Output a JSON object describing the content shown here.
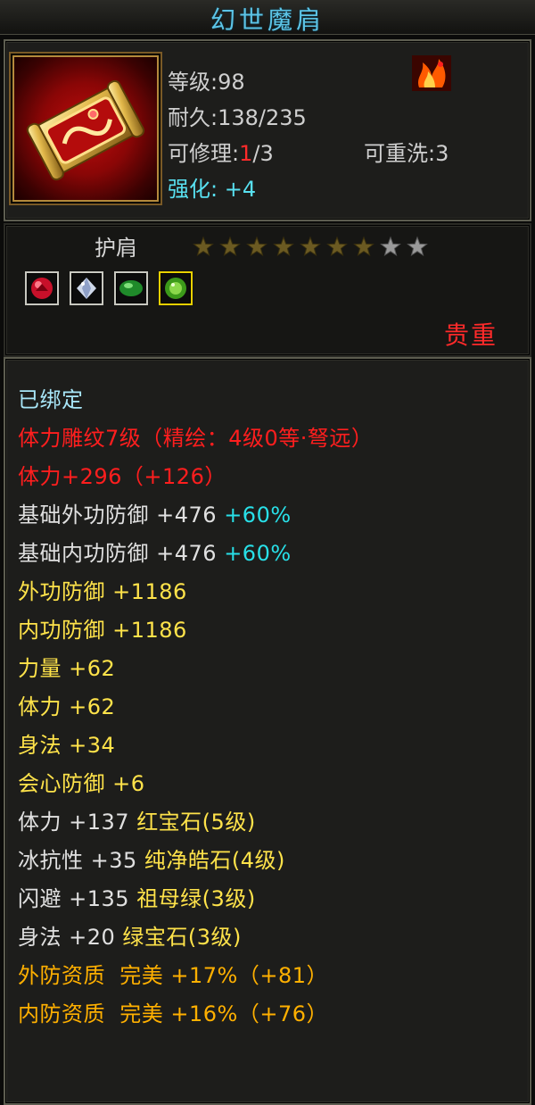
{
  "title": "幻世魔肩",
  "item": {
    "icon": "golden-shoulder-scroll-icon",
    "level_label": "等级",
    "level_value": "98",
    "durability_label": "耐久",
    "durability_value": "138/235",
    "repair_label": "可修理",
    "repair_current": "1",
    "repair_total": "/3",
    "rewash_label": "可重洗",
    "rewash_value": "3",
    "enhance_label": "强化",
    "enhance_value": "+4",
    "badge_icon": "flame-badge-icon"
  },
  "slot": {
    "name": "护肩",
    "stars_filled": 7,
    "stars_total": 9,
    "gems": [
      "red-gem-icon",
      "diamond-gem-icon",
      "emerald-gem-icon",
      "green-gem-icon"
    ],
    "selected_gem_index": 3,
    "rarity": "贵重"
  },
  "colors": {
    "cyan": "#a8e6f8",
    "red": "#ff1e1e",
    "white": "#e0e0e0",
    "yellow": "#ffe34a",
    "orange": "#ffb000",
    "teal": "#28e0e8",
    "title": "#5cc4e6",
    "star_filled": "#6b5a22",
    "star_empty": "#9a9a9a"
  },
  "attributes": [
    {
      "segments": [
        {
          "text": "已绑定",
          "color": "cyan"
        }
      ]
    },
    {
      "segments": [
        {
          "text": "体力雕纹7级（精绘：4级0等·弩远）",
          "color": "red"
        }
      ]
    },
    {
      "segments": [
        {
          "text": "体力+296（+126）",
          "color": "red"
        }
      ]
    },
    {
      "segments": [
        {
          "text": "基础外功防御 +476 ",
          "color": "white"
        },
        {
          "text": "+60%",
          "color": "teal"
        }
      ]
    },
    {
      "segments": [
        {
          "text": "基础内功防御 +476 ",
          "color": "white"
        },
        {
          "text": "+60%",
          "color": "teal"
        }
      ]
    },
    {
      "segments": [
        {
          "text": "外功防御 +1186",
          "color": "yellow"
        }
      ]
    },
    {
      "segments": [
        {
          "text": "内功防御 +1186",
          "color": "yellow"
        }
      ]
    },
    {
      "segments": [
        {
          "text": "力量 +62",
          "color": "yellow"
        }
      ]
    },
    {
      "segments": [
        {
          "text": "体力 +62",
          "color": "yellow"
        }
      ]
    },
    {
      "segments": [
        {
          "text": "身法 +34",
          "color": "yellow"
        }
      ]
    },
    {
      "segments": [
        {
          "text": "会心防御 +6",
          "color": "yellow"
        }
      ]
    },
    {
      "segments": [
        {
          "text": "体力 +137 ",
          "color": "white"
        },
        {
          "text": "红宝石(5级)",
          "color": "yellow"
        }
      ]
    },
    {
      "segments": [
        {
          "text": "冰抗性 +35 ",
          "color": "white"
        },
        {
          "text": "纯净皓石(4级)",
          "color": "yellow"
        }
      ]
    },
    {
      "segments": [
        {
          "text": "闪避 +135 ",
          "color": "white"
        },
        {
          "text": "祖母绿(3级)",
          "color": "yellow"
        }
      ]
    },
    {
      "segments": [
        {
          "text": "身法 +20 ",
          "color": "white"
        },
        {
          "text": "绿宝石(3级)",
          "color": "yellow"
        }
      ]
    },
    {
      "segments": [
        {
          "text": "外防资质  完美 +17%（+81）",
          "color": "orange"
        }
      ]
    },
    {
      "segments": [
        {
          "text": "内防资质  完美 +16%（+76）",
          "color": "orange"
        }
      ]
    }
  ]
}
